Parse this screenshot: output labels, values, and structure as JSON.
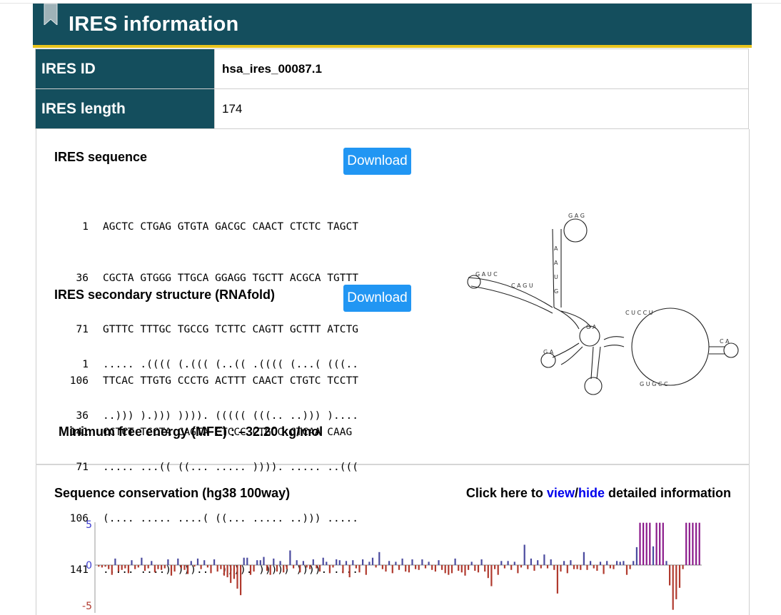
{
  "header": {
    "title": "IRES information"
  },
  "info": [
    {
      "key": "IRES ID",
      "value": "hsa_ires_00087.1"
    },
    {
      "key": "IRES length",
      "value": "174"
    }
  ],
  "sequence_section": {
    "title": "IRES sequence",
    "download_label": "Download",
    "rows": [
      {
        "num": "1",
        "text": "AGCTC CTGAG GTGTA GACGC CAACT CTCTC TAGCT"
      },
      {
        "num": "36",
        "text": "CGCTA GTGGG TTGCA GGAGG TGCTT ACGCA TGTTT"
      },
      {
        "num": "71",
        "text": "GTTTC TTTGC TGCCG TCTTC CAGTT GCTTT ATCTG"
      },
      {
        "num": "106",
        "text": "TTCAC TTGTG CCCTG ACTTT CAACT CTGTC TCCTT"
      },
      {
        "num": "141",
        "text": "CCTCT TCCTA CAGTA CTCCC CTGCC CTCAA CAAG"
      }
    ]
  },
  "structure_section": {
    "title": "IRES secondary structure (RNAfold)",
    "download_label": "Download",
    "rows": [
      {
        "num": "1",
        "text": "..... .(((( (.((( (..(( .(((( (...( (((.."
      },
      {
        "num": "36",
        "text": "..))) ).))) )))). ((((( (((.. ..))) )...."
      },
      {
        "num": "71",
        "text": "..... ...(( ((... ..... )))). ..... ..((("
      },
      {
        "num": "106",
        "text": "(.... ..... ....( ((... ..... ..))) ....."
      },
      {
        "num": "141",
        "text": "..... ....) )))..  )))). ))))) )))). ...."
      }
    ],
    "mfe_text": "Minimum free energy (MFE) : –32.20 kg/mol"
  },
  "conservation_section": {
    "title": "Sequence conservation (hg38 100way)",
    "toggle_prefix": "Click here to ",
    "view_label": "view",
    "separator": "/",
    "hide_label": "hide",
    "toggle_suffix": " detailed information"
  },
  "colors": {
    "header_bg": "#144e5d",
    "header_accent": "#e8c31b",
    "button": "#2196f3",
    "link": "#0000ee",
    "positive_bar": "#4a4a9e",
    "negative_bar": "#b03a2e",
    "high_bar": "#8b1a8b",
    "axis_label": "#3c3ccf"
  },
  "chart_data": {
    "type": "bar",
    "title": "Sequence conservation (hg38 100way)",
    "ylim": [
      -5,
      5
    ],
    "yticks": [
      "5",
      "0",
      "-5"
    ],
    "values": [
      -0.2,
      -0.3,
      -0.2,
      -0.5,
      -1.2,
      0.8,
      -0.8,
      -0.6,
      -0.4,
      -1.0,
      0.6,
      -0.5,
      -0.3,
      0.9,
      -0.7,
      -0.4,
      0.5,
      -0.9,
      -0.5,
      -0.6,
      -0.4,
      0.7,
      -1.3,
      -0.8,
      0.8,
      -0.4,
      -0.6,
      -1.1,
      0.5,
      -0.2,
      0.8,
      -0.5,
      0.6,
      -0.3,
      -1.0,
      0.7,
      -0.8,
      -0.5,
      -1.3,
      -1.5,
      -2.2,
      -1.7,
      -2.9,
      -3.7,
      0.9,
      0.9,
      -1.2,
      -0.8,
      0.6,
      0.6,
      1.0,
      -0.7,
      -1.2,
      0.8,
      -0.8,
      0.5,
      -0.9,
      -0.5,
      1.8,
      -0.4,
      0.6,
      -0.9,
      0.5,
      -0.3,
      -0.5,
      0.7,
      -0.4,
      -0.8,
      0.9,
      0.4,
      -1.0,
      -0.3,
      0.7,
      0.6,
      -1.0,
      0.5,
      -1.5,
      0.6,
      -0.4,
      -0.9,
      0.7,
      -1.2,
      0.4,
      0.9,
      -0.3,
      1.6,
      -0.5,
      -0.8,
      0.5,
      -1.0,
      0.4,
      -0.6,
      0.8,
      -0.8,
      -0.9,
      0.7,
      -0.5,
      -0.6,
      0.7,
      -0.4,
      0.4,
      -0.6,
      -0.8,
      0.6,
      -0.6,
      -1.0,
      -1.2,
      -1.0,
      0.8,
      -0.7,
      -0.9,
      -1.3,
      -0.6,
      0.4,
      -0.7,
      -0.9,
      0.7,
      -0.8,
      -1.6,
      -2.6,
      -0.5,
      -1.2,
      0.5,
      -0.4,
      0.5,
      -0.6,
      0.4,
      -1.0,
      -0.3,
      2.5,
      -0.5,
      0.8,
      -0.7,
      0.6,
      -0.4,
      1.3,
      -0.4,
      0.7,
      -0.6,
      -3.5,
      -0.8,
      0.5,
      -1.0,
      0.6,
      -0.5,
      -0.5,
      -0.6,
      1.6,
      -0.6,
      0.5,
      -0.4,
      -0.7,
      0.4,
      -1.1,
      0.5,
      -0.4,
      -0.5,
      0.5,
      0.4,
      0.5,
      -1.2,
      -0.5,
      0.5,
      2.2,
      5.2,
      5.2,
      5.2,
      5.2,
      2.3,
      5.2,
      5.2,
      5.2,
      0.5,
      -2.5,
      -5.5,
      -4.2,
      -2.8,
      -0.5,
      5.2,
      5.2,
      5.2,
      5.2,
      5.2
    ]
  }
}
